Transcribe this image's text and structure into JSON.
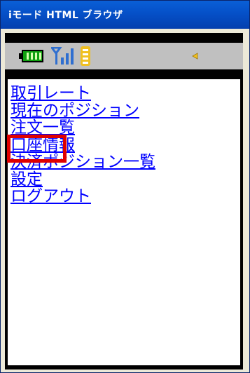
{
  "window": {
    "title": "iモード HTML ブラウザ"
  },
  "status_bar": {
    "icons": [
      "battery-icon",
      "signal-strength-icon",
      "imode-mail-icon",
      "scroll-indicator-icon"
    ],
    "battery_color": "#10a010",
    "signal_color": "#2f6fd0",
    "indicator_color": "#f0c020"
  },
  "menu": {
    "items": [
      {
        "label": "取引レート"
      },
      {
        "label": "現在のポジション"
      },
      {
        "label": "注文一覧"
      },
      {
        "label": "口座情報"
      },
      {
        "label": "決済ポジション一覧"
      },
      {
        "label": "設定",
        "highlighted": true
      },
      {
        "label": "ログアウト"
      }
    ]
  },
  "colors": {
    "link": "#0000ff",
    "highlight_box": "#e00000",
    "titlebar": "#0550c8"
  }
}
